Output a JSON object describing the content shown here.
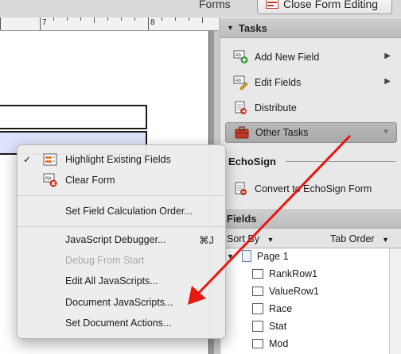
{
  "topbar": {
    "forms_label": "Forms",
    "close_button": "Close Form Editing"
  },
  "ruler": {
    "marks": [
      "7",
      "8"
    ]
  },
  "tasks": {
    "title": "Tasks",
    "items": [
      {
        "label": "Add New Field",
        "icon": "add-field-icon",
        "has_menu": true
      },
      {
        "label": "Edit Fields",
        "icon": "edit-fields-icon",
        "has_menu": true
      },
      {
        "label": "Distribute",
        "icon": "distribute-icon",
        "has_menu": false
      },
      {
        "label": "Other Tasks",
        "icon": "toolbox-icon",
        "has_menu": true,
        "selected": true
      }
    ]
  },
  "echosign": {
    "title": "EchoSign",
    "item": "Convert to EchoSign Form"
  },
  "fields": {
    "title": "Fields",
    "sort_by": "Sort By",
    "tab_order": "Tab Order",
    "tree": [
      {
        "label": "Page 1",
        "type": "page"
      },
      {
        "label": "RankRow1",
        "type": "text-field"
      },
      {
        "label": "ValueRow1",
        "type": "text-field"
      },
      {
        "label": "Race",
        "type": "dropdown-field"
      },
      {
        "label": "Stat",
        "type": "dropdown-field"
      },
      {
        "label": "Mod",
        "type": "text-field"
      }
    ]
  },
  "context_menu": {
    "items": [
      {
        "label": "Highlight Existing Fields",
        "checked": true,
        "icon": "highlight-fields-icon"
      },
      {
        "label": "Clear Form",
        "icon": "clear-form-icon"
      },
      {
        "label": "Set Field Calculation Order..."
      },
      {
        "label": "JavaScript Debugger...",
        "shortcut": "⌘J"
      },
      {
        "label": "Debug From Start",
        "disabled": true
      },
      {
        "label": "Edit All JavaScripts..."
      },
      {
        "label": "Document JavaScripts..."
      },
      {
        "label": "Set Document Actions..."
      }
    ]
  },
  "colors": {
    "annotation_arrow": "#e8170f",
    "highlighted_field": "#dde3fb"
  }
}
